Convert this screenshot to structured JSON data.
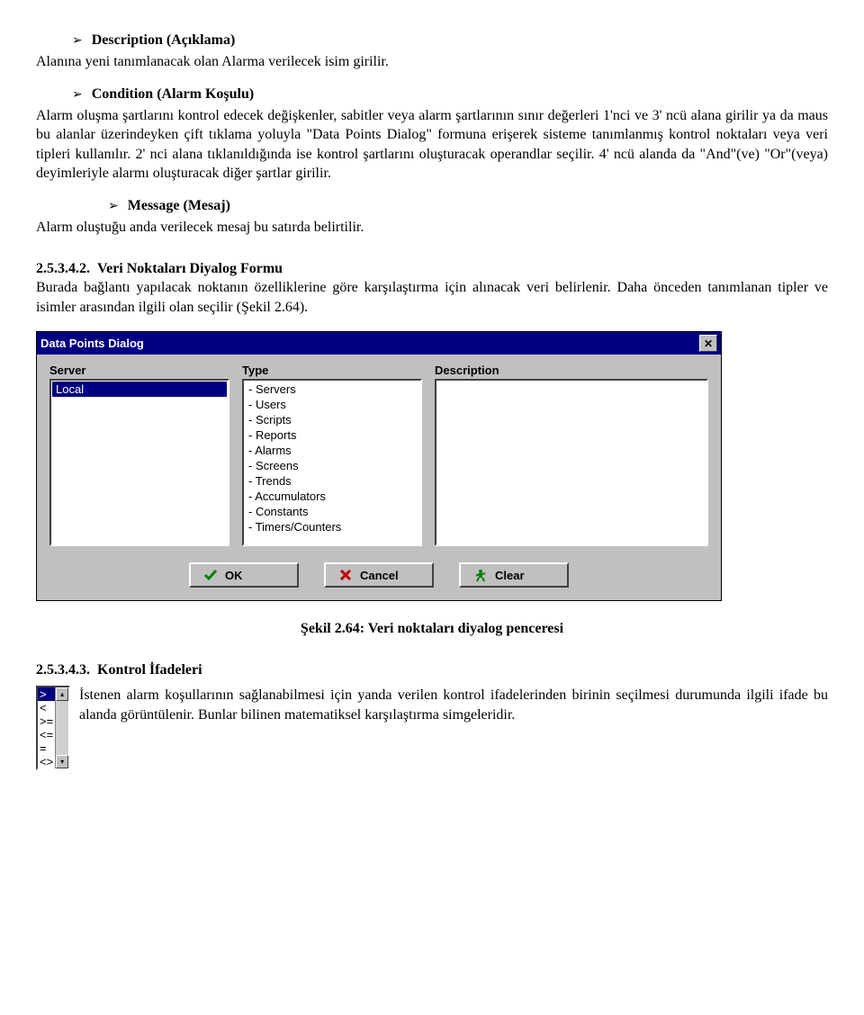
{
  "doc": {
    "description": {
      "title": "Description (Açıklama)",
      "body": "Alanına yeni tanımlanacak olan Alarma verilecek isim girilir."
    },
    "condition": {
      "title": "Condition (Alarm Koşulu)",
      "body": "Alarm oluşma şartlarını kontrol edecek değişkenler, sabitler veya alarm şartlarının sınır değerleri 1'nci ve 3' ncü alana girilir ya da maus bu alanlar üzerindeyken çift tıklama yoluyla \"Data Points Dialog\" formuna erişerek sisteme tanımlanmış kontrol noktaları veya veri tipleri kullanılır. 2' nci alana tıklanıldığında ise kontrol şartlarını oluşturacak operandlar seçilir. 4' ncü alanda da \"And\"(ve) \"Or\"(veya) deyimleriyle alarmı oluşturacak diğer şartlar girilir."
    },
    "message": {
      "title": "Message (Mesaj)",
      "body": "Alarm oluştuğu anda verilecek mesaj bu satırda belirtilir."
    },
    "sec2_5_3_4_2": {
      "num": "2.5.3.4.2.",
      "title": "Veri Noktaları Diyalog Formu",
      "body": "Burada bağlantı yapılacak noktanın özelliklerine göre karşılaştırma için alınacak veri belirlenir. Daha önceden tanımlanan tipler ve isimler arasından ilgili olan seçilir (Şekil 2.64)."
    },
    "caption": "Şekil 2.64: Veri noktaları diyalog penceresi",
    "sec2_5_3_4_3": {
      "num": "2.5.3.4.3.",
      "title": "Kontrol İfadeleri",
      "body": "İstenen alarm koşullarının sağlanabilmesi için yanda verilen kontrol ifadelerinden birinin seçilmesi durumunda ilgili ifade bu alanda görüntülenir. Bunlar bilinen matematiksel karşılaştırma simgeleridir."
    }
  },
  "dialog": {
    "title": "Data Points Dialog",
    "server_label": "Server",
    "type_label": "Type",
    "desc_label": "Description",
    "server_items": [
      "Local"
    ],
    "type_items": [
      "- Servers",
      "- Users",
      "- Scripts",
      "- Reports",
      "- Alarms",
      "- Screens",
      "- Trends",
      "- Accumulators",
      "- Constants",
      "- Timers/Counters"
    ],
    "buttons": {
      "ok": "OK",
      "cancel": "Cancel",
      "clear": "Clear"
    }
  },
  "ctrl": {
    "items": [
      ">",
      "<",
      ">=",
      "<=",
      "=",
      "<>"
    ]
  }
}
